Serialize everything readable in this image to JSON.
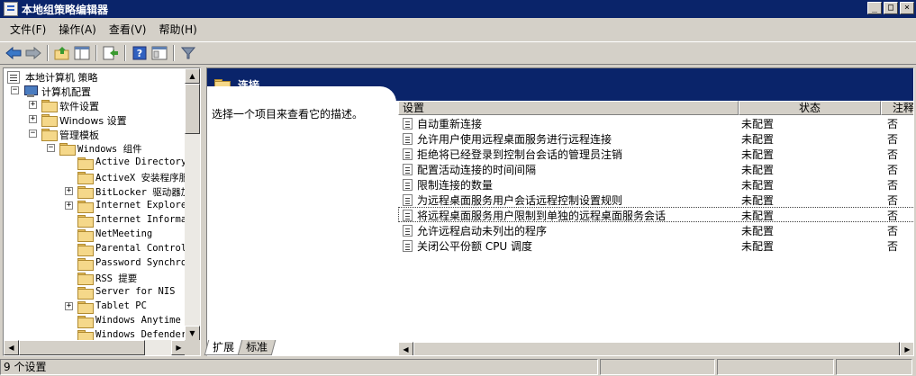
{
  "window": {
    "title": "本地组策略编辑器",
    "buttons": [
      "_",
      "□",
      "×"
    ]
  },
  "menu": [
    "文件(F)",
    "操作(A)",
    "查看(V)",
    "帮助(H)"
  ],
  "toolbar": {
    "icons": [
      "back-icon",
      "forward-icon",
      "up-folder-icon",
      "show-hide-tree-icon",
      "export-list-icon",
      "help-icon",
      "properties-icon",
      "filter-icon"
    ]
  },
  "tree": {
    "items": [
      {
        "label": "本地计算机 策略",
        "icon": "doc-icon",
        "expander": "",
        "level": 0
      },
      {
        "label": "计算机配置",
        "icon": "computer-icon",
        "expander": "−",
        "level": 1
      },
      {
        "label": "软件设置",
        "icon": "folder-icon",
        "expander": "+",
        "level": 2
      },
      {
        "label": "Windows 设置",
        "icon": "folder-icon",
        "expander": "+",
        "level": 2
      },
      {
        "label": "管理模板",
        "icon": "folder-icon",
        "expander": "−",
        "level": 2
      },
      {
        "label": "Windows 组件",
        "icon": "folder-icon",
        "expander": "−",
        "level": 3
      },
      {
        "label": "Active Directory F",
        "icon": "folder-icon",
        "expander": "",
        "level": 4
      },
      {
        "label": "ActiveX 安装程序服",
        "icon": "folder-icon",
        "expander": "",
        "level": 4
      },
      {
        "label": "BitLocker 驱动器加",
        "icon": "folder-icon",
        "expander": "+",
        "level": 4
      },
      {
        "label": "Internet Explorer",
        "icon": "folder-icon",
        "expander": "+",
        "level": 4
      },
      {
        "label": "Internet Informati",
        "icon": "folder-icon",
        "expander": "",
        "level": 4
      },
      {
        "label": "NetMeeting",
        "icon": "folder-icon",
        "expander": "",
        "level": 4
      },
      {
        "label": "Parental Controls",
        "icon": "folder-icon",
        "expander": "",
        "level": 4
      },
      {
        "label": "Password Synchron",
        "icon": "folder-icon",
        "expander": "",
        "level": 4
      },
      {
        "label": "RSS 提要",
        "icon": "folder-icon",
        "expander": "",
        "level": 4
      },
      {
        "label": "Server for NIS",
        "icon": "folder-icon",
        "expander": "",
        "level": 4
      },
      {
        "label": "Tablet PC",
        "icon": "folder-icon",
        "expander": "+",
        "level": 4
      },
      {
        "label": "Windows Anytime U",
        "icon": "folder-icon",
        "expander": "",
        "level": 4
      },
      {
        "label": "Windows Defender",
        "icon": "folder-icon",
        "expander": "",
        "level": 4
      }
    ]
  },
  "panel": {
    "title": "连接",
    "description": "选择一个项目来查看它的描述。"
  },
  "list": {
    "columns": [
      "设置",
      "状态",
      "注释"
    ],
    "rows": [
      {
        "name": "自动重新连接",
        "status": "未配置",
        "note": "否"
      },
      {
        "name": "允许用户使用远程桌面服务进行远程连接",
        "status": "未配置",
        "note": "否"
      },
      {
        "name": "拒绝将已经登录到控制台会话的管理员注销",
        "status": "未配置",
        "note": "否"
      },
      {
        "name": "配置活动连接的时间间隔",
        "status": "未配置",
        "note": "否"
      },
      {
        "name": "限制连接的数量",
        "status": "未配置",
        "note": "否"
      },
      {
        "name": "为远程桌面服务用户会话远程控制设置规则",
        "status": "未配置",
        "note": "否"
      },
      {
        "name": "将远程桌面服务用户限制到单独的远程桌面服务会话",
        "status": "未配置",
        "note": "否"
      },
      {
        "name": "允许远程启动未列出的程序",
        "status": "未配置",
        "note": "否"
      },
      {
        "name": "关闭公平份额 CPU 调度",
        "status": "未配置",
        "note": "否"
      }
    ],
    "focused_index": 6
  },
  "tabs": [
    "扩展",
    "标准"
  ],
  "status": {
    "text": "9 个设置"
  },
  "colors": {
    "titlebar": "#0a246a",
    "face": "#d4d0c8",
    "window": "#ffffff"
  }
}
